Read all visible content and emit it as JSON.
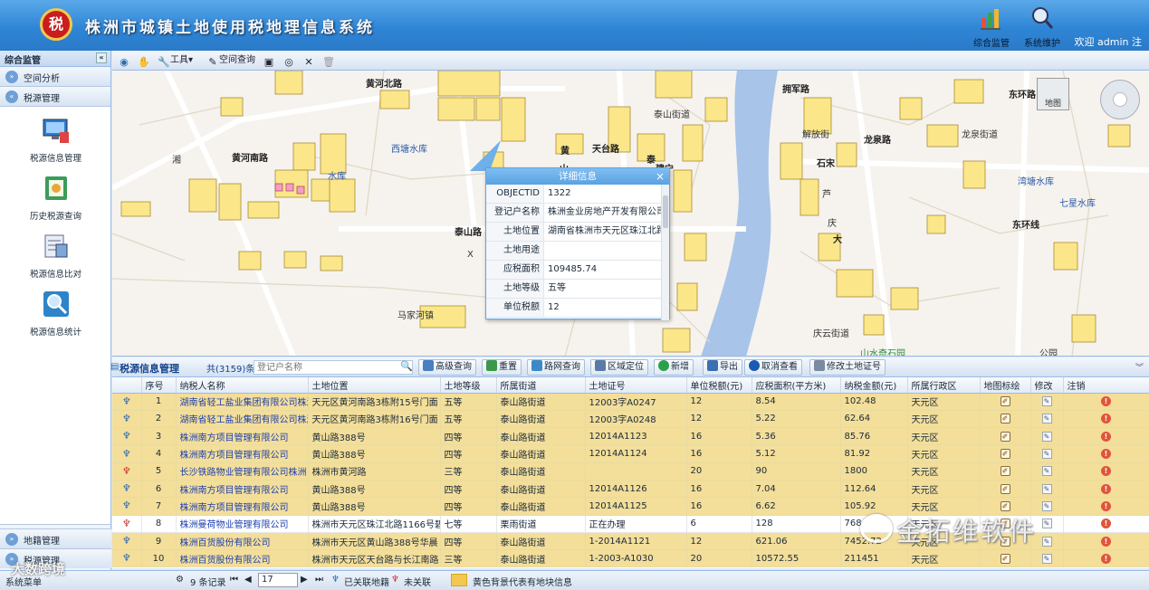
{
  "header": {
    "title": "株洲市城镇土地使用税地理信息系统",
    "logo_glyph": "税",
    "tools": [
      {
        "label": "综合监管",
        "icon": "chart-icon"
      },
      {
        "label": "系统维护",
        "icon": "search-gear-icon"
      }
    ],
    "welcome": "欢迎 admin 注"
  },
  "sidebar": {
    "title": "综合监管",
    "sections": [
      {
        "label": "空间分析"
      },
      {
        "label": "税源管理"
      }
    ],
    "items": [
      {
        "label": "税源信息管理",
        "icon": "monitor-icon"
      },
      {
        "label": "历史税源查询",
        "icon": "history-icon"
      },
      {
        "label": "税源信息比对",
        "icon": "compare-icon"
      },
      {
        "label": "税源信息统计",
        "icon": "statistics-icon"
      }
    ],
    "bottom_sections": [
      {
        "label": "地籍管理"
      },
      {
        "label": "税源管理"
      },
      {
        "label": "系统菜单"
      }
    ]
  },
  "map_toolbar": {
    "tools_label": "工具",
    "spatial_query_label": "空间查询"
  },
  "map": {
    "basemap_label": "地图",
    "labels": [
      {
        "text": "黄河北路",
        "kind": "road"
      },
      {
        "text": "西塘水库",
        "kind": "water"
      },
      {
        "text": "泰山路",
        "kind": "road"
      },
      {
        "text": "马家河镇",
        "kind": "place"
      },
      {
        "text": "黄河南路",
        "kind": "road"
      },
      {
        "text": "湘",
        "kind": "place"
      },
      {
        "text": "泰山街道",
        "kind": "place"
      },
      {
        "text": "X",
        "kind": "place"
      },
      {
        "text": "水库",
        "kind": "water"
      },
      {
        "text": "黄",
        "kind": "road"
      },
      {
        "text": "山",
        "kind": "road"
      },
      {
        "text": "天台路",
        "kind": "road"
      },
      {
        "text": "泰",
        "kind": "road"
      },
      {
        "text": "建宁",
        "kind": "road"
      },
      {
        "text": "拥军路",
        "kind": "road"
      },
      {
        "text": "解放街",
        "kind": "road"
      },
      {
        "text": "龙泉路",
        "kind": "road"
      },
      {
        "text": "龙泉街道",
        "kind": "place"
      },
      {
        "text": "石宋",
        "kind": "road"
      },
      {
        "text": "芦",
        "kind": "place"
      },
      {
        "text": "庆",
        "kind": "place"
      },
      {
        "text": "大",
        "kind": "road"
      },
      {
        "text": "庆云街道",
        "kind": "place"
      },
      {
        "text": "山水奇石园",
        "kind": "place"
      },
      {
        "text": "东环路",
        "kind": "road"
      },
      {
        "text": "湾塘水库",
        "kind": "water"
      },
      {
        "text": "七星水库",
        "kind": "water"
      },
      {
        "text": "东环线",
        "kind": "road"
      },
      {
        "text": "公园",
        "kind": "place"
      }
    ]
  },
  "popup": {
    "title": "详细信息",
    "rows": [
      {
        "k": "OBJECTID",
        "v": "1322"
      },
      {
        "k": "登记户名称",
        "v": "株洲金业房地产开发有限公司"
      },
      {
        "k": "土地位置",
        "v": "湖南省株洲市天元区珠江北路"
      },
      {
        "k": "土地用途",
        "v": ""
      },
      {
        "k": "应税面积",
        "v": "109485.74"
      },
      {
        "k": "土地等级",
        "v": "五等"
      },
      {
        "k": "单位税额",
        "v": "12"
      }
    ]
  },
  "grid_toolbar": {
    "title": "税源信息管理",
    "count": "共(3159)条",
    "search_placeholder": "登记户名称",
    "buttons": [
      {
        "label": "高级查询",
        "color": "#4a7fc0"
      },
      {
        "label": "重置",
        "color": "#3a9a4a"
      },
      {
        "label": "路网查询",
        "color": "#3a8ac8"
      },
      {
        "label": "区域定位",
        "color": "#5a7aa8"
      },
      {
        "label": "新增",
        "color": "#2aa04a"
      },
      {
        "label": "导出",
        "color": "#3a70b0"
      },
      {
        "label": "取消查看",
        "color": "#1a5ab0"
      },
      {
        "label": "修改土地证号",
        "color": "#7a8aa0"
      }
    ]
  },
  "grid": {
    "columns": [
      "",
      "序号",
      "纳税人名称",
      "土地位置",
      "土地等级",
      "所属街道",
      "土地证号",
      "单位税额(元)",
      "应税面积(平方米)",
      "纳税金额(元)",
      "所属行政区",
      "地图标绘",
      "修改",
      "注销"
    ],
    "rows": [
      {
        "linked": true,
        "no": "1",
        "name": "湖南省轻工盐业集团有限公司株洲",
        "loc": "天元区黄河南路3栋附15号门面",
        "grade": "五等",
        "street": "泰山路街道",
        "cert": "12003字A0247",
        "unit": "12",
        "area": "8.54",
        "amount": "102.48",
        "district": "天元区",
        "bg": "yellow"
      },
      {
        "linked": true,
        "no": "2",
        "name": "湖南省轻工盐业集团有限公司株洲",
        "loc": "天元区黄河南路3栋附16号门面",
        "grade": "五等",
        "street": "泰山路街道",
        "cert": "12003字A0248",
        "unit": "12",
        "area": "5.22",
        "amount": "62.64",
        "district": "天元区",
        "bg": "yellow"
      },
      {
        "linked": true,
        "no": "3",
        "name": "株洲南方项目管理有限公司",
        "loc": "黄山路388号",
        "grade": "四等",
        "street": "泰山路街道",
        "cert": "12014A1123",
        "unit": "16",
        "area": "5.36",
        "amount": "85.76",
        "district": "天元区",
        "bg": "yellow"
      },
      {
        "linked": true,
        "no": "4",
        "name": "株洲南方项目管理有限公司",
        "loc": "黄山路388号",
        "grade": "四等",
        "street": "泰山路街道",
        "cert": "12014A1124",
        "unit": "16",
        "area": "5.12",
        "amount": "81.92",
        "district": "天元区",
        "bg": "yellow"
      },
      {
        "linked": false,
        "no": "5",
        "name": "长沙铁路物业管理有限公司株洲",
        "loc": "株洲市黄河路",
        "grade": "三等",
        "street": "泰山路街道",
        "cert": "",
        "unit": "20",
        "area": "90",
        "amount": "1800",
        "district": "天元区",
        "bg": "yellow"
      },
      {
        "linked": true,
        "no": "6",
        "name": "株洲南方项目管理有限公司",
        "loc": "黄山路388号",
        "grade": "四等",
        "street": "泰山路街道",
        "cert": "12014A1126",
        "unit": "16",
        "area": "7.04",
        "amount": "112.64",
        "district": "天元区",
        "bg": "yellow"
      },
      {
        "linked": true,
        "no": "7",
        "name": "株洲南方项目管理有限公司",
        "loc": "黄山路388号",
        "grade": "四等",
        "street": "泰山路街道",
        "cert": "12014A1125",
        "unit": "16",
        "area": "6.62",
        "amount": "105.92",
        "district": "天元区",
        "bg": "yellow"
      },
      {
        "linked": false,
        "no": "8",
        "name": "株洲曼荷物业管理有限公司",
        "loc": "株洲市天元区珠江北路1166号碧",
        "grade": "七等",
        "street": "栗雨街道",
        "cert": "正在办理",
        "unit": "6",
        "area": "128",
        "amount": "768",
        "district": "天元区",
        "bg": "white"
      },
      {
        "linked": true,
        "no": "9",
        "name": "株洲百货股份有限公司",
        "loc": "株洲市天元区黄山路388号华晨",
        "grade": "四等",
        "street": "泰山路街道",
        "cert": "1-2014A1121",
        "unit": "12",
        "area": "621.06",
        "amount": "7452.72",
        "district": "天元区",
        "bg": "yellow"
      },
      {
        "linked": true,
        "no": "10",
        "name": "株洲百货股份有限公司",
        "loc": "株洲市天元区天台路与长江南路",
        "grade": "三等",
        "street": "泰山路街道",
        "cert": "1-2003-A1030",
        "unit": "20",
        "area": "10572.55",
        "amount": "211451",
        "district": "天元区",
        "bg": "yellow"
      }
    ]
  },
  "statusbar": {
    "records": "9 条记录",
    "page_value": "17",
    "linked_label": "已关联地籍",
    "unlinked_label": "未关联",
    "legend_text": "黄色背景代表有地块信息",
    "legend_color": "#f2c850"
  },
  "watermark": {
    "brand": "金拓维软件",
    "overlay": "大数跨境"
  }
}
